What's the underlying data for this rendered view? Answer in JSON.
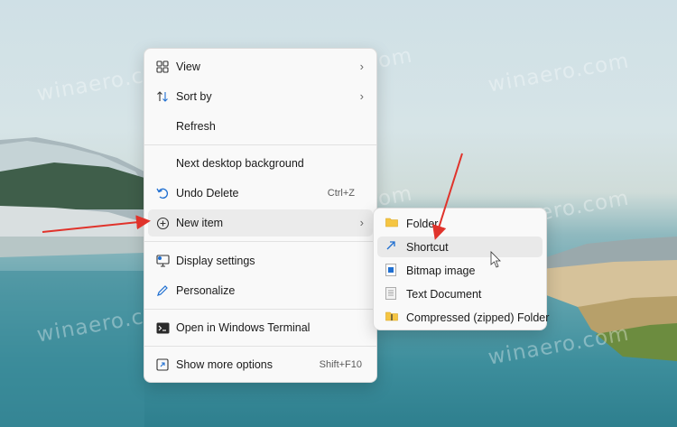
{
  "watermark": "winaero.com",
  "context_menu": {
    "items": [
      {
        "label": "View",
        "icon": "grid-view-icon",
        "has_submenu": true
      },
      {
        "label": "Sort by",
        "icon": "sort-icon",
        "has_submenu": true
      },
      {
        "label": "Refresh",
        "icon": "",
        "has_submenu": false
      },
      {
        "label": "Next desktop background",
        "icon": "",
        "has_submenu": false
      },
      {
        "label": "Undo Delete",
        "icon": "undo-icon",
        "shortcut": "Ctrl+Z"
      },
      {
        "label": "New item",
        "icon": "plus-circle-icon",
        "has_submenu": true,
        "highlighted": true
      },
      {
        "label": "Display settings",
        "icon": "display-icon"
      },
      {
        "label": "Personalize",
        "icon": "pen-icon"
      },
      {
        "label": "Open in Windows Terminal",
        "icon": "terminal-icon"
      },
      {
        "label": "Show more options",
        "icon": "more-options-icon",
        "shortcut": "Shift+F10"
      }
    ]
  },
  "submenu": {
    "items": [
      {
        "label": "Folder",
        "icon": "folder-icon"
      },
      {
        "label": "Shortcut",
        "icon": "shortcut-arrow-icon",
        "highlighted": true
      },
      {
        "label": "Bitmap image",
        "icon": "bitmap-icon"
      },
      {
        "label": "Text Document",
        "icon": "text-document-icon"
      },
      {
        "label": "Compressed (zipped) Folder",
        "icon": "zip-folder-icon"
      }
    ]
  },
  "colors": {
    "accent": "#1f6fd1",
    "annotation_arrow": "#e0332b",
    "folder": "#f5c542"
  }
}
